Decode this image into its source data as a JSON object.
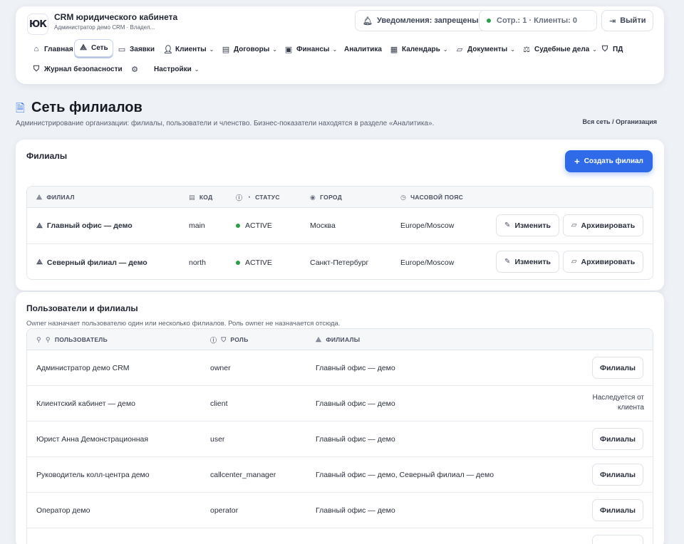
{
  "app": {
    "logo_text": "ЮК",
    "title": "CRM юридического кабинета",
    "subtitle": "Администратор демо CRM · Владел..."
  },
  "header_actions": {
    "notifications": "Уведомления: запрещены",
    "counts": "Сотр.: 1 · Клиенты: 0",
    "logout": "Выйти"
  },
  "nav": {
    "home": "Главная",
    "network": "Сеть",
    "requests": "Заявки",
    "clients": "Клиенты",
    "contracts": "Договоры",
    "finance": "Финансы",
    "analytics": "Аналитика",
    "calendar": "Календарь",
    "documents": "Документы",
    "court_cases": "Судебные дела",
    "pd": "ПД",
    "security_log": "Журнал безопасности",
    "settings": "Настройки"
  },
  "page": {
    "title": "Сеть филиалов",
    "description": "Администрирование организации: филиалы, пользователи и членство. Бизнес-показатели находятся в разделе «Аналитика».",
    "breadcrumb": "Вся сеть / Организация"
  },
  "branches": {
    "title": "Филиалы",
    "create_label": "Создать филиал",
    "columns": {
      "branch": "ФИЛИАЛ",
      "code": "КОД",
      "status": "СТАТУС",
      "city": "ГОРОД",
      "timezone": "ЧАСОВОЙ ПОЯС"
    },
    "edit_label": "Изменить",
    "archive_label": "Архивировать",
    "rows": [
      {
        "name": "Главный офис — демо",
        "code": "main",
        "status": "ACTIVE",
        "city": "Москва",
        "timezone": "Europe/Moscow"
      },
      {
        "name": "Северный филиал — демо",
        "code": "north",
        "status": "ACTIVE",
        "city": "Санкт-Петербург",
        "timezone": "Europe/Moscow"
      }
    ]
  },
  "users": {
    "title": "Пользователи и филиалы",
    "subtitle": "Owner назначает пользователю один или несколько филиалов. Роль owner не назначается отсюда.",
    "columns": {
      "user": "ПОЛЬЗОВАТЕЛЬ",
      "role": "РОЛЬ",
      "branches": "ФИЛИАЛЫ"
    },
    "branches_button": "Филиалы",
    "inherited_note_line1": "Наследуется от",
    "inherited_note_line2": "клиента",
    "rows": [
      {
        "name": "Администратор демо CRM",
        "role": "owner",
        "branches": "Главный офис — демо"
      },
      {
        "name": "Клиентский кабинет — демо",
        "role": "client",
        "branches": "Главный офис — демо"
      },
      {
        "name": "Юрист Анна Демонстрационная",
        "role": "user",
        "branches": "Главный офис — демо"
      },
      {
        "name": "Руководитель колл-центра демо",
        "role": "callcenter_manager",
        "branches": "Главный офис — демо, Северный филиал — демо"
      },
      {
        "name": "Оператор демо",
        "role": "operator",
        "branches": "Главный офис — демо"
      }
    ]
  },
  "colors": {
    "accent": "#2f6be8",
    "status_active": "#27a048",
    "background": "#eef1f6"
  }
}
